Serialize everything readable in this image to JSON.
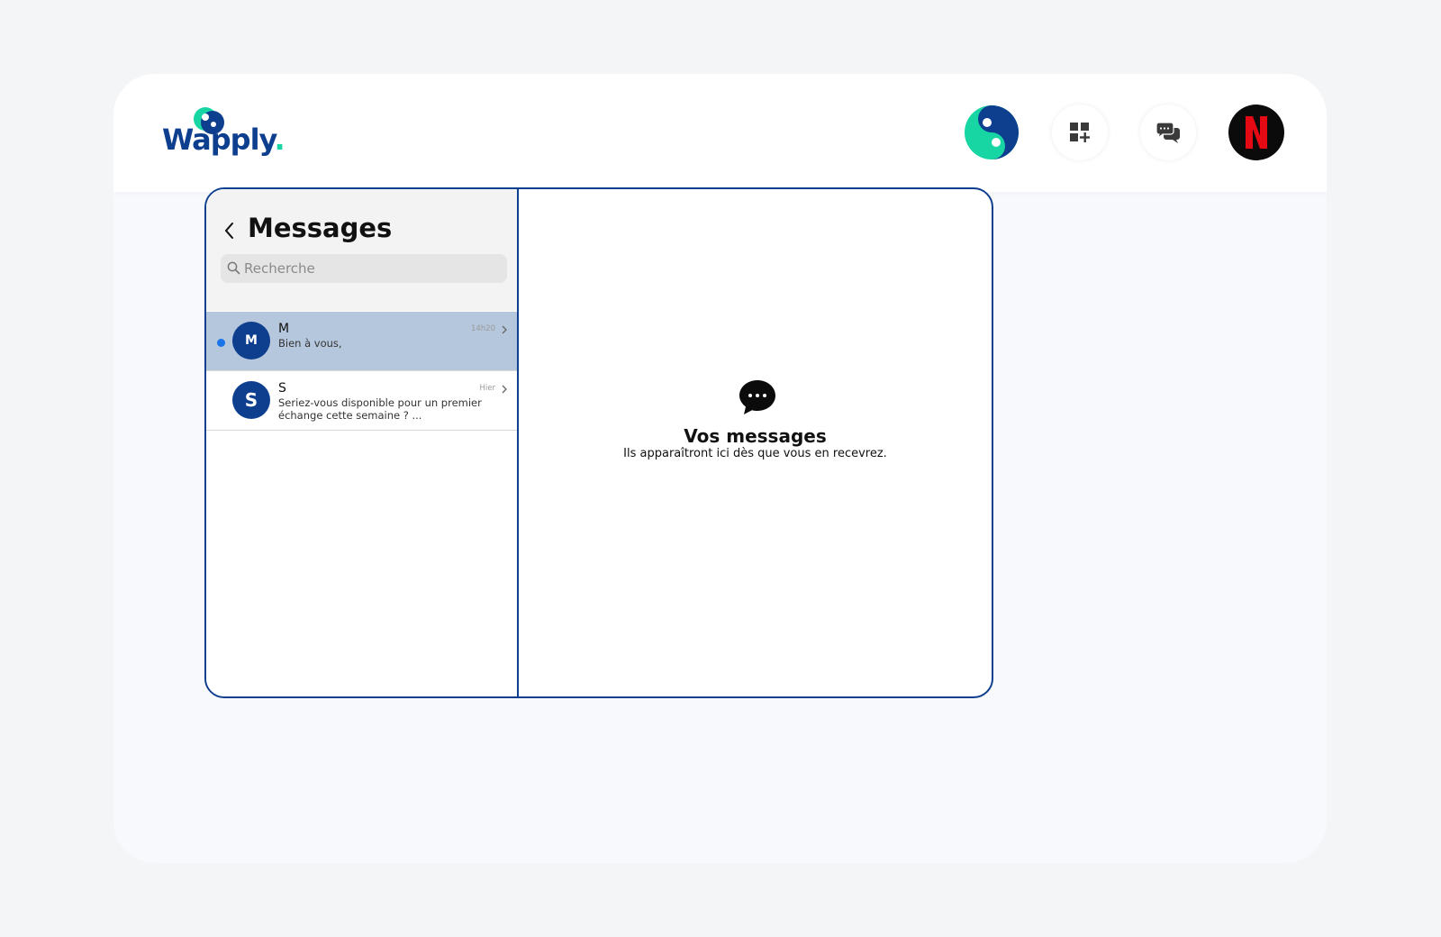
{
  "header": {
    "logo_text": "Wapply",
    "logo_dot": ".",
    "brand_colors": {
      "primary": "#0e3f8f",
      "accent": "#18d6a4"
    },
    "buttons": [
      {
        "name": "wapply-brand",
        "icon": "wapply-logo-icon"
      },
      {
        "name": "add-widget",
        "icon": "grid-plus-icon"
      },
      {
        "name": "messages",
        "icon": "chat-bubbles-icon"
      },
      {
        "name": "company-profile",
        "icon": "netflix-logo-icon"
      }
    ]
  },
  "messenger": {
    "title": "Messages",
    "search_placeholder": "Recherche",
    "conversations": [
      {
        "avatar_letter": "M",
        "name": "M",
        "preview": "Bien à vous,",
        "time": "14h20",
        "unread": true,
        "selected": true
      },
      {
        "avatar_letter": "S",
        "name": "S",
        "preview": "Seriez-vous disponible pour un premier échange cette semaine ? ...",
        "time": "Hier",
        "unread": false,
        "selected": false
      }
    ],
    "empty_state": {
      "icon": "speech-bubble-icon",
      "title": "Vos messages",
      "subtitle": "Ils apparaîtront ici dès que vous en recevrez."
    }
  }
}
